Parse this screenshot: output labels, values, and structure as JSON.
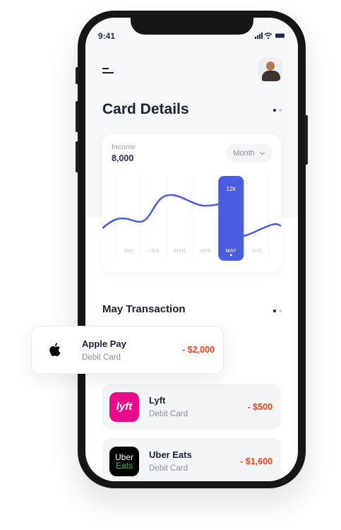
{
  "status": {
    "time": "9:41"
  },
  "header": {
    "title": "Card Details"
  },
  "income": {
    "label": "Income",
    "value": "8,000",
    "period": "Month"
  },
  "chart_data": {
    "type": "line",
    "categories": [
      "JAN",
      "FEB",
      "MAR",
      "APR",
      "MAY",
      "JUN"
    ],
    "highlight": {
      "category": "MAY",
      "label": "12k"
    },
    "accent": "#4a5ce0"
  },
  "section": {
    "title": "May Transaction"
  },
  "transactions": [
    {
      "name": "Apple Pay",
      "sub": "Debit Card",
      "amount": "- $2,000",
      "logo": "apple-icon"
    },
    {
      "name": "Lyft",
      "sub": "Debit Card",
      "amount": "- $500",
      "logo": "lyft",
      "color": "#ea0b8c"
    },
    {
      "name": "Uber Eats",
      "sub": "Debit Card",
      "amount": "- $1,600",
      "logo": "Uber Eats",
      "color": "#000000"
    }
  ]
}
